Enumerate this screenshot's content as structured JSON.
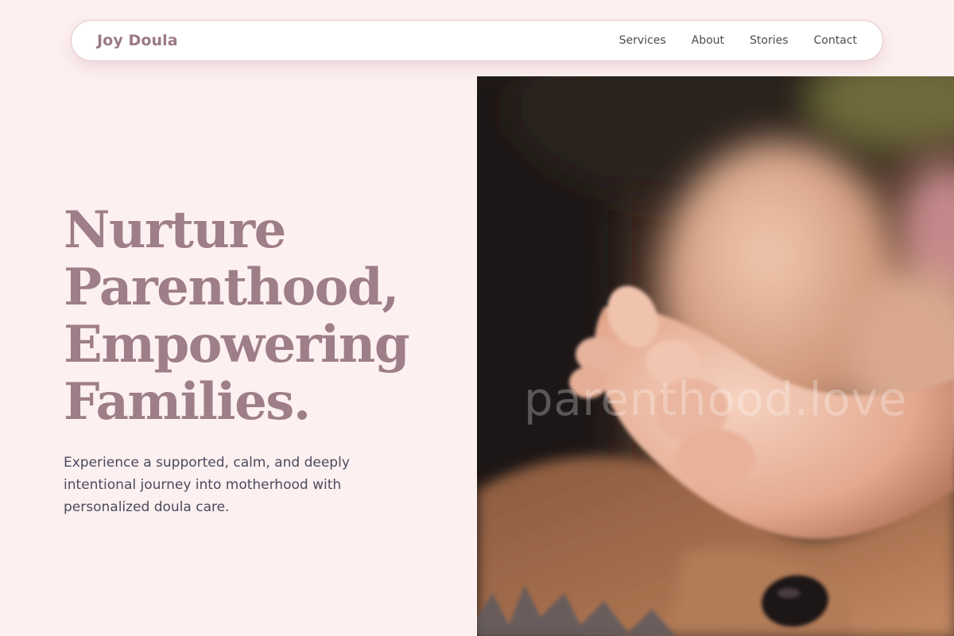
{
  "brand": {
    "name": "Joy Doula"
  },
  "nav": {
    "links": [
      {
        "label": "Services"
      },
      {
        "label": "About"
      },
      {
        "label": "Stories"
      },
      {
        "label": "Contact"
      }
    ]
  },
  "hero": {
    "headline_lines": [
      "Nurture",
      "Parenthood,",
      "Empowering",
      "Families."
    ],
    "subtext": "Experience a supported, calm, and deeply intentional journey into motherhood with personalized doula care.",
    "image": {
      "watermark": "parenthood.love"
    }
  },
  "colors": {
    "background": "#fdf0f0",
    "brand": "#9a7a84",
    "headline": "#9e7e88",
    "body_text": "#4a4a5e",
    "nav_border": "#e4c6cc"
  }
}
